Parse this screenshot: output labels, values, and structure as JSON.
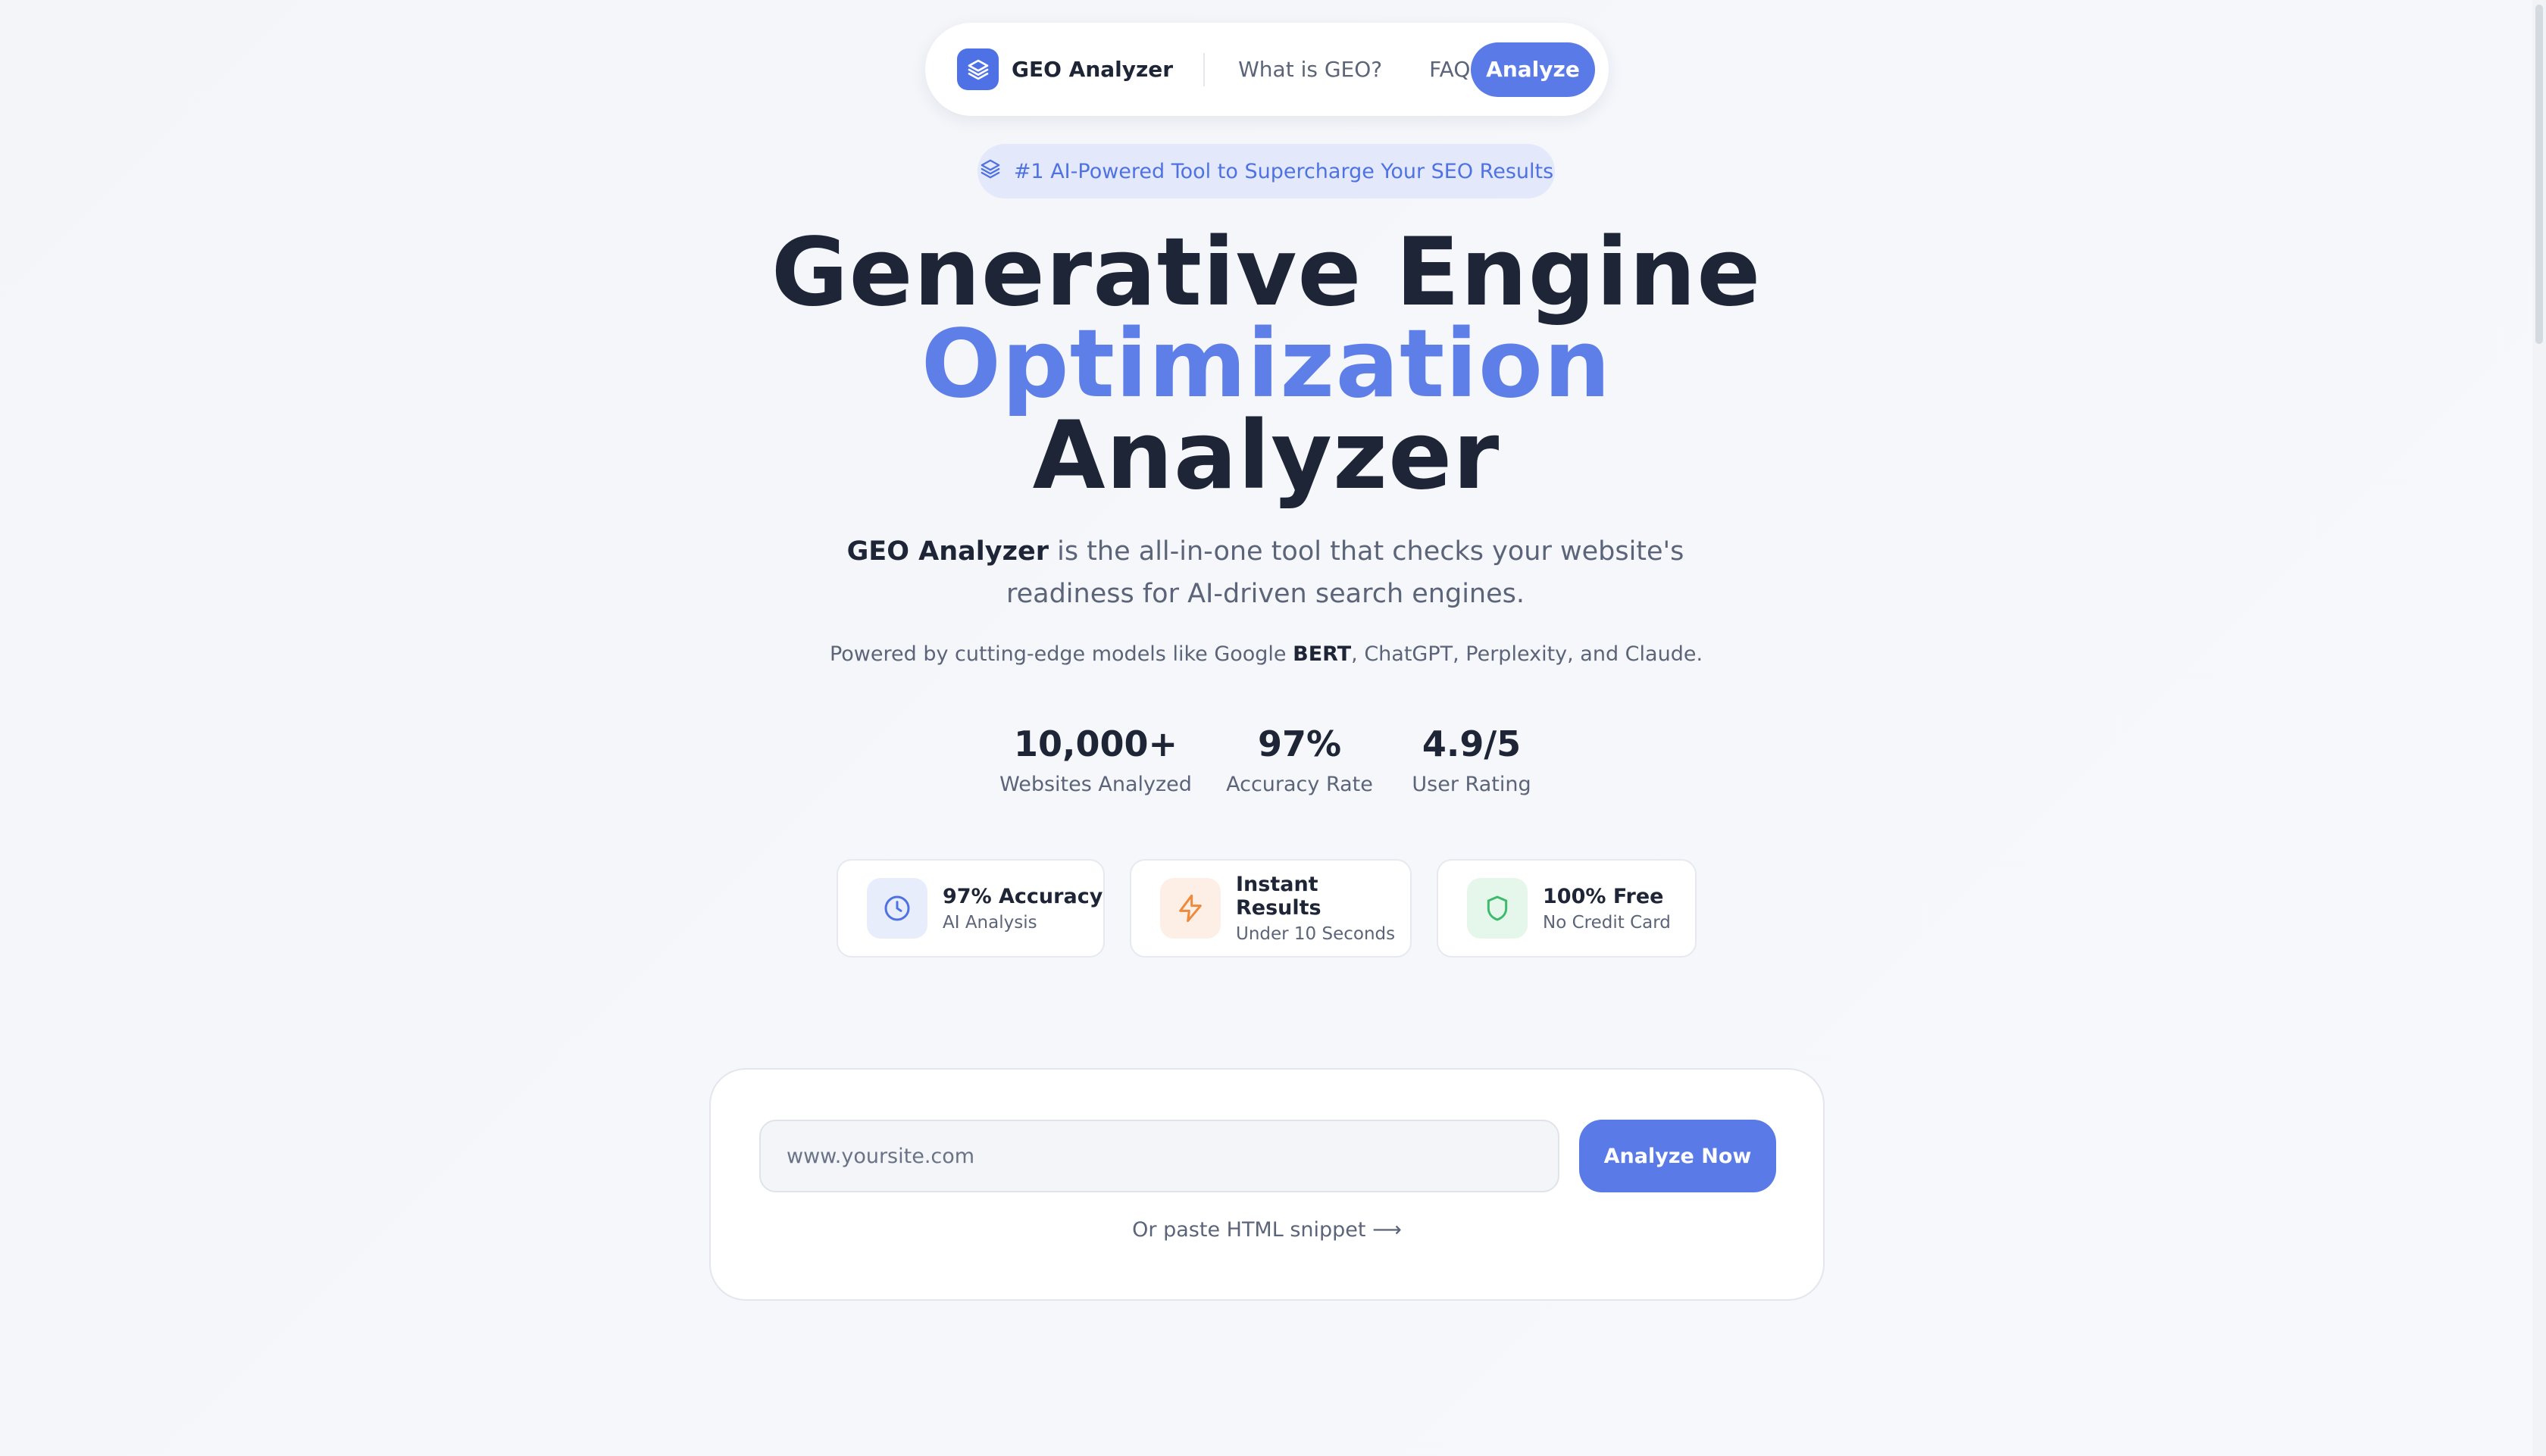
{
  "nav": {
    "brand": "GEO Analyzer",
    "links": [
      "What is GEO?",
      "FAQ"
    ],
    "cta": "Analyze",
    "icon": "layers-icon"
  },
  "badge": {
    "text": "#1 AI-Powered Tool to Supercharge Your SEO Results",
    "icon": "layers-icon"
  },
  "hero": {
    "line1": "Generative Engine",
    "line2": "Optimization",
    "line3": "Analyzer",
    "accent_color": "#5e7fe8"
  },
  "lead": {
    "strong": "GEO Analyzer",
    "text": " is the all-in-one tool that checks your website's readiness for AI-driven search engines."
  },
  "powered": {
    "prefix": "Powered by cutting-edge models like Google ",
    "strong": "BERT",
    "suffix": ", ChatGPT, Perplexity, and Claude."
  },
  "stats": [
    {
      "value": "10,000+",
      "label": "Websites Analyzed"
    },
    {
      "value": "97%",
      "label": "Accuracy Rate"
    },
    {
      "value": "4.9/5",
      "label": "User Rating"
    }
  ],
  "features": [
    {
      "title": "97% Accuracy",
      "subtitle": "AI Analysis",
      "icon": "clock-icon",
      "color": "#4f72e2"
    },
    {
      "title": "Instant Results",
      "subtitle": "Under 10 Seconds",
      "icon": "lightning-icon",
      "color": "#ee8a3c"
    },
    {
      "title": "100% Free",
      "subtitle": "No Credit Card",
      "icon": "shield-icon",
      "color": "#3dba6c"
    }
  ],
  "analyzer": {
    "placeholder": "www.yoursite.com",
    "value": "",
    "button": "Analyze Now",
    "paste_link": "Or paste HTML snippet ⟶"
  },
  "colors": {
    "primary": "#5a7ae8",
    "text_dark": "#1e2536",
    "text_muted": "#5b6478"
  }
}
